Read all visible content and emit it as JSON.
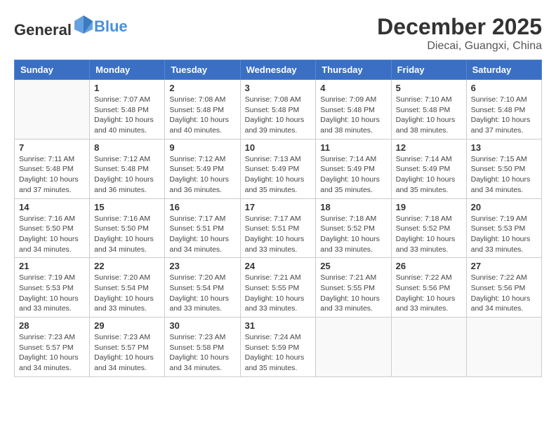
{
  "header": {
    "logo_general": "General",
    "logo_blue": "Blue",
    "month_year": "December 2025",
    "location": "Diecai, Guangxi, China"
  },
  "weekdays": [
    "Sunday",
    "Monday",
    "Tuesday",
    "Wednesday",
    "Thursday",
    "Friday",
    "Saturday"
  ],
  "weeks": [
    [
      {
        "day": "",
        "info": ""
      },
      {
        "day": "1",
        "info": "Sunrise: 7:07 AM\nSunset: 5:48 PM\nDaylight: 10 hours\nand 40 minutes."
      },
      {
        "day": "2",
        "info": "Sunrise: 7:08 AM\nSunset: 5:48 PM\nDaylight: 10 hours\nand 40 minutes."
      },
      {
        "day": "3",
        "info": "Sunrise: 7:08 AM\nSunset: 5:48 PM\nDaylight: 10 hours\nand 39 minutes."
      },
      {
        "day": "4",
        "info": "Sunrise: 7:09 AM\nSunset: 5:48 PM\nDaylight: 10 hours\nand 38 minutes."
      },
      {
        "day": "5",
        "info": "Sunrise: 7:10 AM\nSunset: 5:48 PM\nDaylight: 10 hours\nand 38 minutes."
      },
      {
        "day": "6",
        "info": "Sunrise: 7:10 AM\nSunset: 5:48 PM\nDaylight: 10 hours\nand 37 minutes."
      }
    ],
    [
      {
        "day": "7",
        "info": "Sunrise: 7:11 AM\nSunset: 5:48 PM\nDaylight: 10 hours\nand 37 minutes."
      },
      {
        "day": "8",
        "info": "Sunrise: 7:12 AM\nSunset: 5:48 PM\nDaylight: 10 hours\nand 36 minutes."
      },
      {
        "day": "9",
        "info": "Sunrise: 7:12 AM\nSunset: 5:49 PM\nDaylight: 10 hours\nand 36 minutes."
      },
      {
        "day": "10",
        "info": "Sunrise: 7:13 AM\nSunset: 5:49 PM\nDaylight: 10 hours\nand 35 minutes."
      },
      {
        "day": "11",
        "info": "Sunrise: 7:14 AM\nSunset: 5:49 PM\nDaylight: 10 hours\nand 35 minutes."
      },
      {
        "day": "12",
        "info": "Sunrise: 7:14 AM\nSunset: 5:49 PM\nDaylight: 10 hours\nand 35 minutes."
      },
      {
        "day": "13",
        "info": "Sunrise: 7:15 AM\nSunset: 5:50 PM\nDaylight: 10 hours\nand 34 minutes."
      }
    ],
    [
      {
        "day": "14",
        "info": "Sunrise: 7:16 AM\nSunset: 5:50 PM\nDaylight: 10 hours\nand 34 minutes."
      },
      {
        "day": "15",
        "info": "Sunrise: 7:16 AM\nSunset: 5:50 PM\nDaylight: 10 hours\nand 34 minutes."
      },
      {
        "day": "16",
        "info": "Sunrise: 7:17 AM\nSunset: 5:51 PM\nDaylight: 10 hours\nand 34 minutes."
      },
      {
        "day": "17",
        "info": "Sunrise: 7:17 AM\nSunset: 5:51 PM\nDaylight: 10 hours\nand 33 minutes."
      },
      {
        "day": "18",
        "info": "Sunrise: 7:18 AM\nSunset: 5:52 PM\nDaylight: 10 hours\nand 33 minutes."
      },
      {
        "day": "19",
        "info": "Sunrise: 7:18 AM\nSunset: 5:52 PM\nDaylight: 10 hours\nand 33 minutes."
      },
      {
        "day": "20",
        "info": "Sunrise: 7:19 AM\nSunset: 5:53 PM\nDaylight: 10 hours\nand 33 minutes."
      }
    ],
    [
      {
        "day": "21",
        "info": "Sunrise: 7:19 AM\nSunset: 5:53 PM\nDaylight: 10 hours\nand 33 minutes."
      },
      {
        "day": "22",
        "info": "Sunrise: 7:20 AM\nSunset: 5:54 PM\nDaylight: 10 hours\nand 33 minutes."
      },
      {
        "day": "23",
        "info": "Sunrise: 7:20 AM\nSunset: 5:54 PM\nDaylight: 10 hours\nand 33 minutes."
      },
      {
        "day": "24",
        "info": "Sunrise: 7:21 AM\nSunset: 5:55 PM\nDaylight: 10 hours\nand 33 minutes."
      },
      {
        "day": "25",
        "info": "Sunrise: 7:21 AM\nSunset: 5:55 PM\nDaylight: 10 hours\nand 33 minutes."
      },
      {
        "day": "26",
        "info": "Sunrise: 7:22 AM\nSunset: 5:56 PM\nDaylight: 10 hours\nand 33 minutes."
      },
      {
        "day": "27",
        "info": "Sunrise: 7:22 AM\nSunset: 5:56 PM\nDaylight: 10 hours\nand 34 minutes."
      }
    ],
    [
      {
        "day": "28",
        "info": "Sunrise: 7:23 AM\nSunset: 5:57 PM\nDaylight: 10 hours\nand 34 minutes."
      },
      {
        "day": "29",
        "info": "Sunrise: 7:23 AM\nSunset: 5:57 PM\nDaylight: 10 hours\nand 34 minutes."
      },
      {
        "day": "30",
        "info": "Sunrise: 7:23 AM\nSunset: 5:58 PM\nDaylight: 10 hours\nand 34 minutes."
      },
      {
        "day": "31",
        "info": "Sunrise: 7:24 AM\nSunset: 5:59 PM\nDaylight: 10 hours\nand 35 minutes."
      },
      {
        "day": "",
        "info": ""
      },
      {
        "day": "",
        "info": ""
      },
      {
        "day": "",
        "info": ""
      }
    ]
  ]
}
